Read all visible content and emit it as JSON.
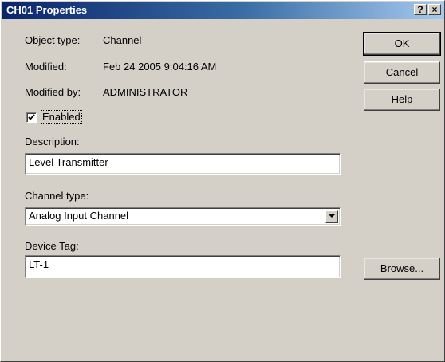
{
  "window": {
    "title": "CH01 Properties",
    "help_glyph": "?",
    "close_glyph": "×"
  },
  "info": {
    "object_type_label": "Object type:",
    "object_type_value": "Channel",
    "modified_label": "Modified:",
    "modified_value": "Feb 24 2005 9:04:16 AM",
    "modified_by_label": "Modified by:",
    "modified_by_value": "ADMINISTRATOR"
  },
  "enabled": {
    "label": "Enabled",
    "checked": true
  },
  "description": {
    "label": "Description:",
    "value": "Level Transmitter"
  },
  "channel_type": {
    "label": "Channel type:",
    "value": "Analog Input Channel"
  },
  "device_tag": {
    "label": "Device Tag:",
    "value": "LT-1"
  },
  "buttons": {
    "ok": "OK",
    "cancel": "Cancel",
    "help": "Help",
    "browse": "Browse..."
  },
  "icons": {
    "check": "checkmark-icon",
    "dropdown": "chevron-down-icon"
  },
  "colors": {
    "title_start": "#0a246a",
    "title_end": "#a6caf0",
    "face": "#d4d0c8"
  }
}
